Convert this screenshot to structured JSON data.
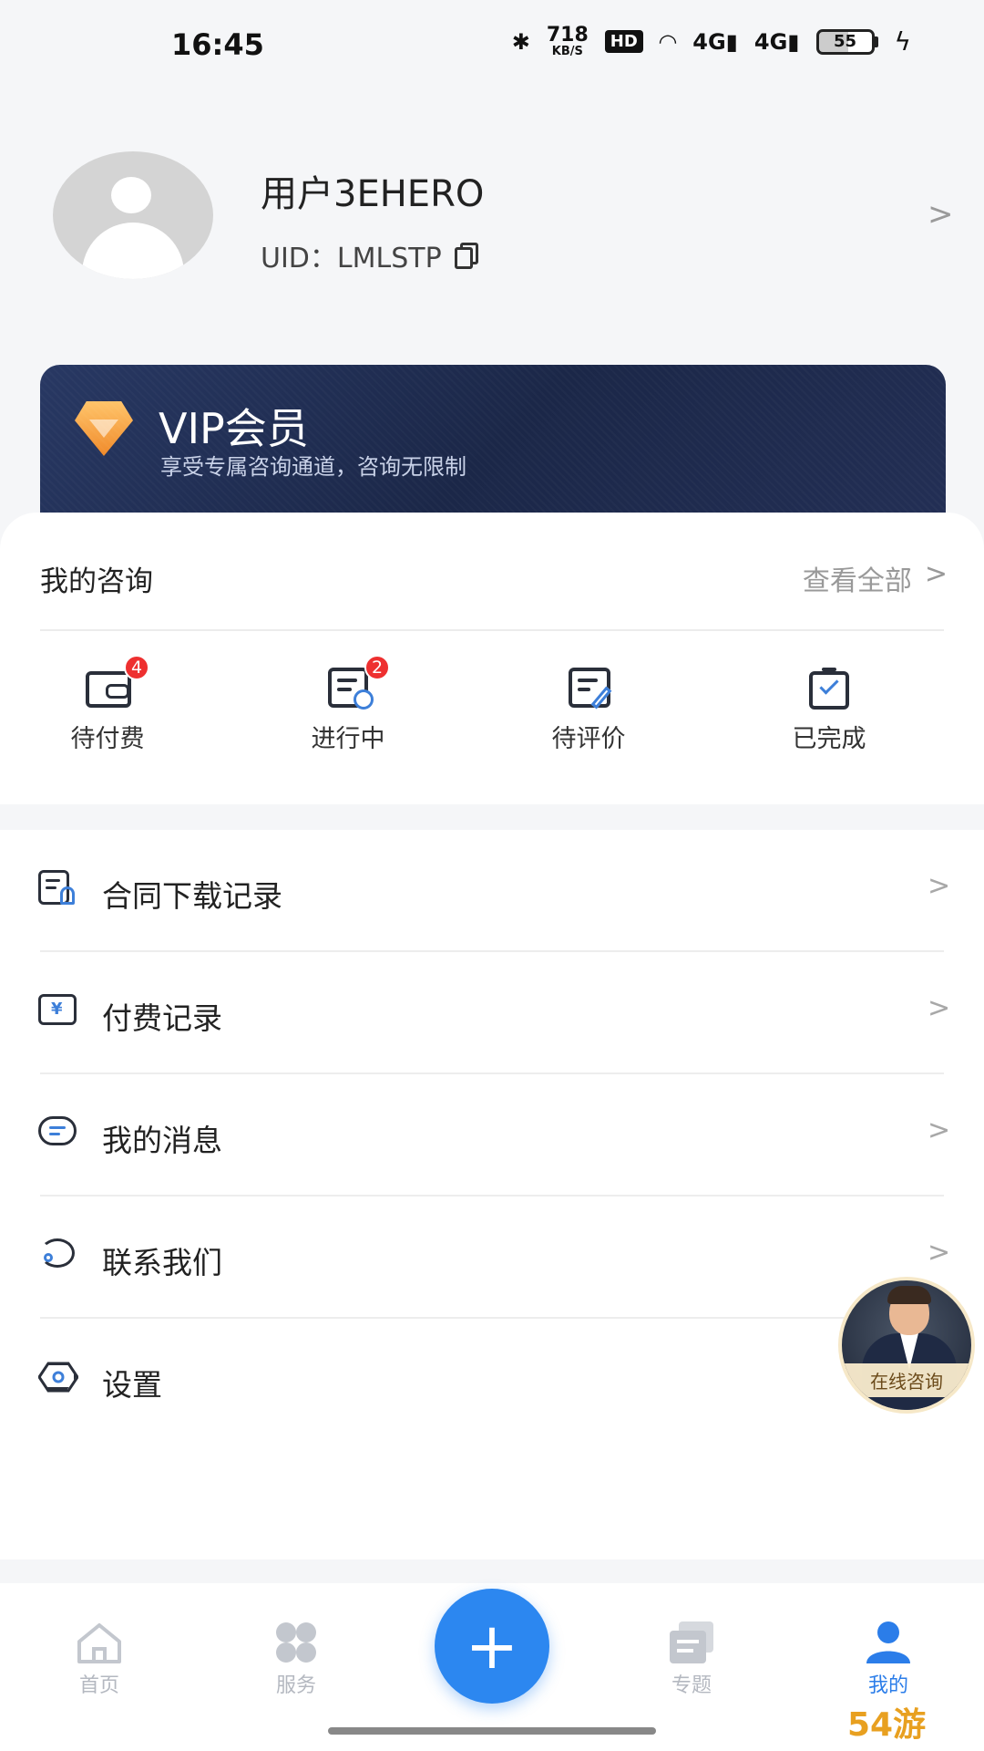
{
  "status_bar": {
    "time": "16:45",
    "net_speed_value": "718",
    "net_speed_unit": "KB/S",
    "hd_label": "HD",
    "signal_1": "4G",
    "signal_2": "4G",
    "battery_level": "55"
  },
  "profile": {
    "username": "用户3EHERO",
    "uid_label": "UID：",
    "uid_value": "LMLSTP"
  },
  "vip": {
    "title": "VIP会员",
    "subtitle": "享受专属咨询通道，咨询无限制"
  },
  "consult": {
    "title": "我的咨询",
    "view_all": "查看全部",
    "orders": [
      {
        "label": "待付费",
        "badge": "4"
      },
      {
        "label": "进行中",
        "badge": "2"
      },
      {
        "label": "待评价",
        "badge": ""
      },
      {
        "label": "已完成",
        "badge": ""
      }
    ]
  },
  "menu": {
    "items": [
      {
        "label": "合同下载记录",
        "icon": "contract-icon"
      },
      {
        "label": "付费记录",
        "icon": "payment-icon"
      },
      {
        "label": "我的消息",
        "icon": "message-icon"
      },
      {
        "label": "联系我们",
        "icon": "contact-icon"
      },
      {
        "label": "设置",
        "icon": "settings-icon"
      }
    ]
  },
  "float_consult": {
    "label": "在线咨询"
  },
  "bottom_nav": {
    "items": [
      {
        "label": "首页",
        "icon": "home-icon"
      },
      {
        "label": "服务",
        "icon": "grid-icon"
      },
      {
        "label": "专题",
        "icon": "topic-icon"
      },
      {
        "label": "我的",
        "icon": "profile-icon",
        "active": true
      }
    ],
    "fab_symbol": "+"
  },
  "watermark": "54游",
  "colors": {
    "accent": "#2c87f0",
    "badge": "#ee3030",
    "vip_bg": "#1f2b4f"
  }
}
